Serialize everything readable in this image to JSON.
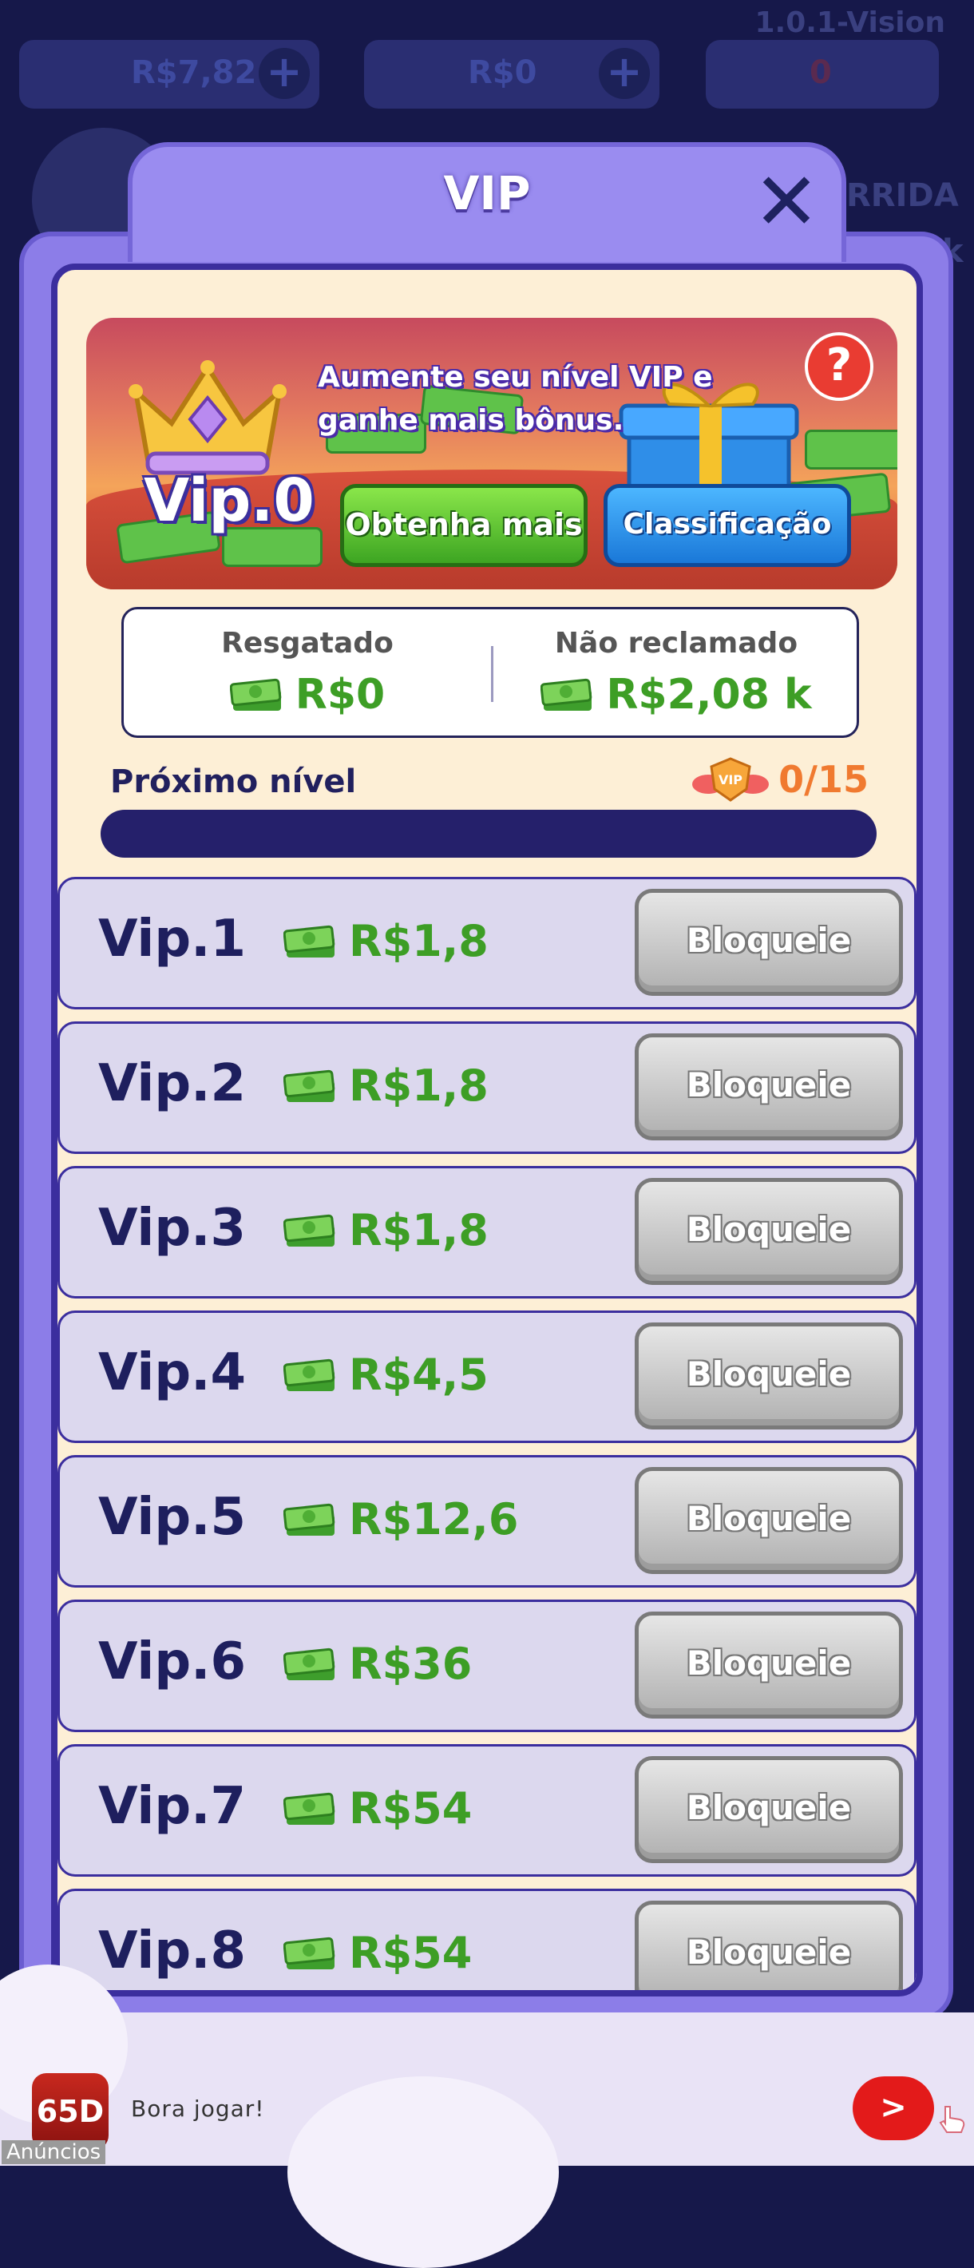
{
  "hud": {
    "version": "1.0.1-Vision",
    "cash": "R$7,82",
    "gems": "R$0",
    "vip_points": "0",
    "side_label": "RRIDA",
    "side_label2": "k"
  },
  "dialog": {
    "title": "VIP",
    "close_icon": "close-icon"
  },
  "banner": {
    "level": "Vip.0",
    "message": "Aumente seu nível VIP e ganhe mais bônus.",
    "help": "?",
    "get_more": "Obtenha mais",
    "ranking": "Classificação"
  },
  "claims": {
    "redeemed_label": "Resgatado",
    "redeemed_value": "R$0",
    "unclaimed_label": "Não reclamado",
    "unclaimed_value": "R$2,08 k"
  },
  "next_level": {
    "label": "Próximo nível",
    "progress_text": "0/15",
    "progress_fraction": 0
  },
  "vip_levels": [
    {
      "name": "Vip.1",
      "reward": "R$1,8",
      "button": "Bloqueie"
    },
    {
      "name": "Vip.2",
      "reward": "R$1,8",
      "button": "Bloqueie"
    },
    {
      "name": "Vip.3",
      "reward": "R$1,8",
      "button": "Bloqueie"
    },
    {
      "name": "Vip.4",
      "reward": "R$4,5",
      "button": "Bloqueie"
    },
    {
      "name": "Vip.5",
      "reward": "R$12,6",
      "button": "Bloqueie"
    },
    {
      "name": "Vip.6",
      "reward": "R$36",
      "button": "Bloqueie"
    },
    {
      "name": "Vip.7",
      "reward": "R$54",
      "button": "Bloqueie"
    },
    {
      "name": "Vip.8",
      "reward": "R$54",
      "button": "Bloqueie"
    }
  ],
  "ad": {
    "logo_text": "65D",
    "text": "Bora jogar!",
    "label": "Anúncios",
    "cta": ">"
  },
  "colors": {
    "panel": "#8c7de8",
    "panel_border": "#3b2e9e",
    "reward_green": "#3d9e25",
    "progress_track": "#25206b",
    "lock_gray": "#b0b0b0"
  }
}
